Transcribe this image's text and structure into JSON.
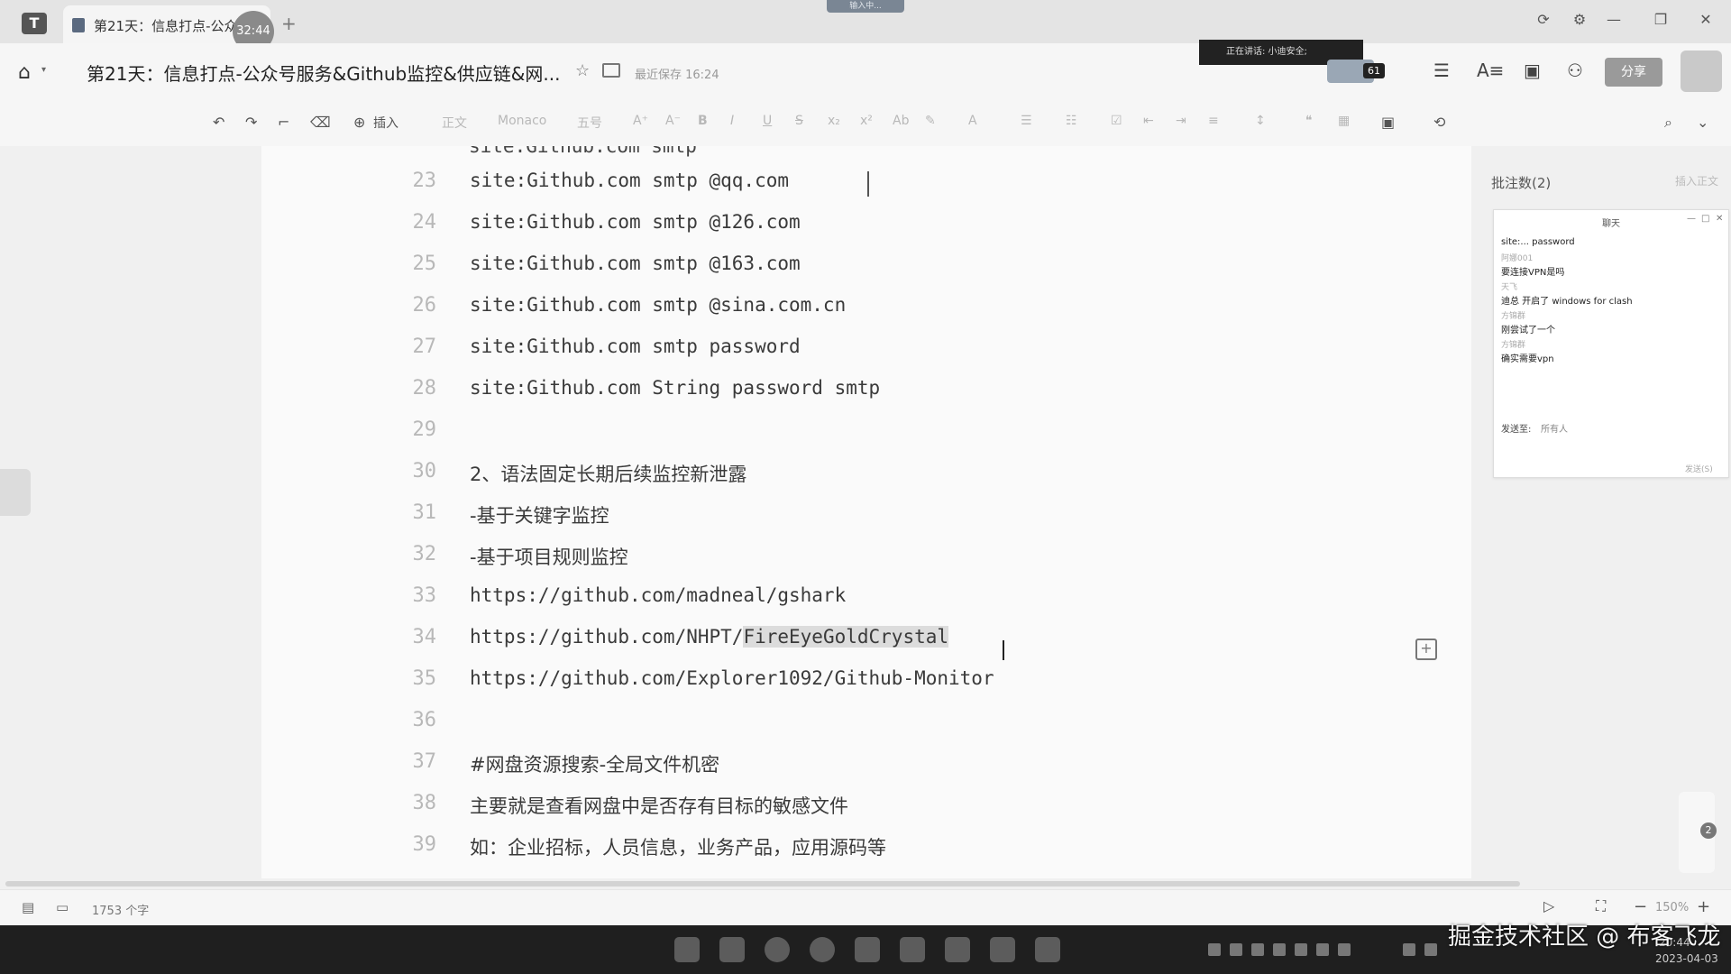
{
  "tab": {
    "title": "第21天：信息打点-公众...",
    "timer": "32:44",
    "new_tab": "+"
  },
  "top_indicator": "输入中...",
  "window": {
    "refresh": "⟳",
    "settings": "⚙",
    "minimize": "—",
    "restore": "❐",
    "close": "✕"
  },
  "header": {
    "doc_title": "第21天：信息打点-公众号服务&Github监控&供应链&网...",
    "sync_status": "最近保存 16:24",
    "speaking": "正在讲话: 小迪安全;",
    "viewer_count": "61",
    "share_label": "分享"
  },
  "toolbar": {
    "insert_label": "插入",
    "style_label": "正文",
    "font_label": "Monaco",
    "size_label": "五号"
  },
  "doc": {
    "partial_line": "site:Github.com smtp",
    "lines": [
      {
        "n": "23",
        "text": "site:Github.com smtp @qq.com"
      },
      {
        "n": "24",
        "text": "site:Github.com smtp @126.com"
      },
      {
        "n": "25",
        "text": "site:Github.com smtp @163.com"
      },
      {
        "n": "26",
        "text": "site:Github.com smtp @sina.com.cn"
      },
      {
        "n": "27",
        "text": "site:Github.com smtp password"
      },
      {
        "n": "28",
        "text": "site:Github.com String password smtp"
      },
      {
        "n": "29",
        "text": ""
      },
      {
        "n": "30",
        "text": "2、语法固定长期后续监控新泄露"
      },
      {
        "n": "31",
        "text": "-基于关键字监控"
      },
      {
        "n": "32",
        "text": "-基于项目规则监控"
      },
      {
        "n": "33",
        "text": "https://github.com/madneal/gshark"
      },
      {
        "n": "34",
        "text_prefix": "https://github.com/NHPT/",
        "text_selected": "FireEyeGoldCrystal"
      },
      {
        "n": "35",
        "text": "https://github.com/Explorer1092/Github-Monitor"
      },
      {
        "n": "36",
        "text": ""
      },
      {
        "n": "37",
        "text": "#网盘资源搜索-全局文件机密"
      },
      {
        "n": "38",
        "text": "主要就是查看网盘中是否存有目标的敏感文件"
      },
      {
        "n": "39",
        "text": "如：企业招标，人员信息，业务产品，应用源码等"
      }
    ]
  },
  "comments": {
    "label": "批注数(2)",
    "right_label": "插入正文"
  },
  "chat": {
    "title": "聊天",
    "messages": [
      {
        "name": "",
        "text": "site:... password"
      },
      {
        "name": "阿娜001",
        "text": "要连接VPN是吗"
      },
      {
        "name": "天飞",
        "text": "迪总 开启了 windows for clash"
      },
      {
        "name": "方锦群",
        "text": "刚尝试了一个"
      },
      {
        "name": "方锦群",
        "text": "确实需要vpn"
      }
    ],
    "send_to": "发送至:",
    "recipient": "所有人",
    "send": "发送(S)"
  },
  "float_badge": "2",
  "status": {
    "word_count": "1753 个字",
    "zoom": "150%"
  },
  "tray": {
    "time": "20:44",
    "date": "2023-04-03"
  },
  "watermark": "掘金技术社区 @ 布客飞龙"
}
